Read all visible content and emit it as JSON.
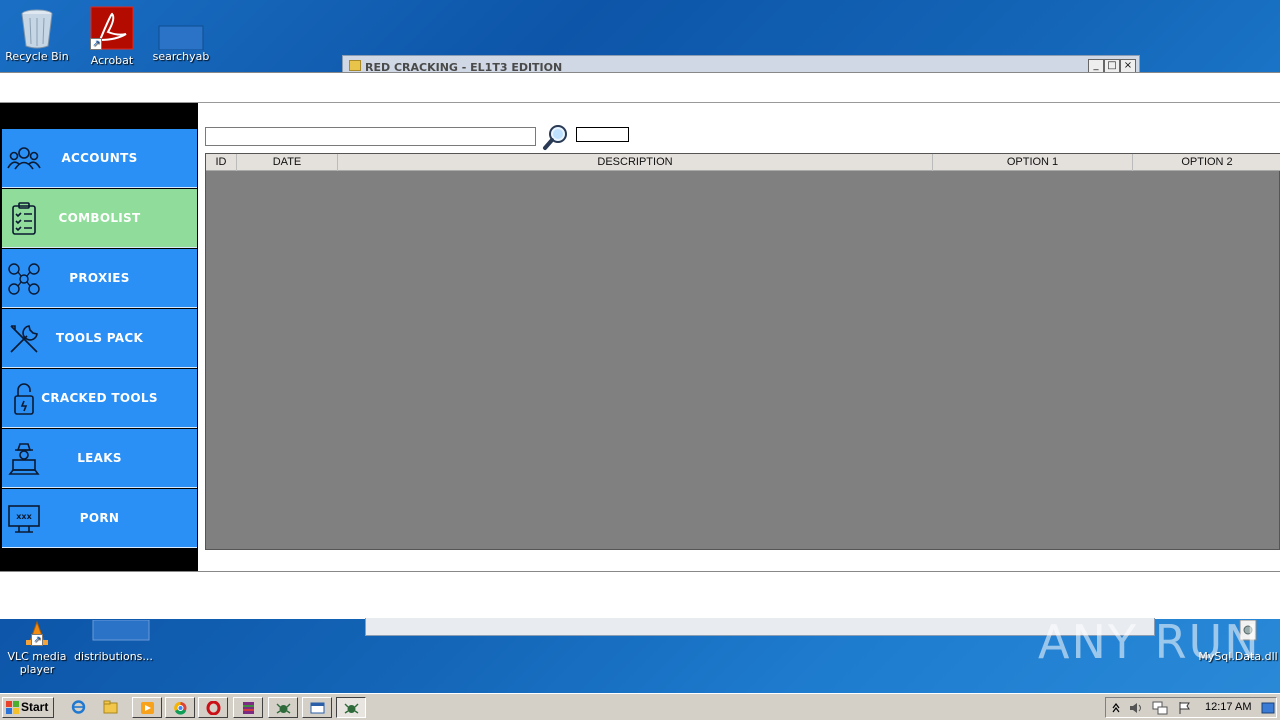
{
  "desktop": {
    "icons": [
      {
        "label": "Recycle Bin"
      },
      {
        "label": "Acrobat"
      },
      {
        "label": "searchyab"
      },
      {
        "label": "VLC media player"
      },
      {
        "label": "distributions..."
      },
      {
        "label": "MySql.Data.dll"
      }
    ],
    "watermark": "ANY RUN"
  },
  "background_window": {
    "title": "RED CRACKING - EL1T3 EDITION",
    "minimize": "_",
    "maximize": "□",
    "close": "×"
  },
  "sidebar": {
    "items": [
      {
        "label": "ACCOUNTS",
        "icon": "users-icon",
        "active": false
      },
      {
        "label": "COMBOLIST",
        "icon": "clipboard-checklist-icon",
        "active": true
      },
      {
        "label": "PROXIES",
        "icon": "network-users-icon",
        "active": false
      },
      {
        "label": "TOOLS PACK",
        "icon": "tools-icon",
        "active": false
      },
      {
        "label": "CRACKED TOOLS",
        "icon": "unlocked-padlock-icon",
        "active": false
      },
      {
        "label": "LEAKS",
        "icon": "hacker-laptop-icon",
        "active": false
      },
      {
        "label": "PORN",
        "icon": "xxx-monitor-icon",
        "active": false
      }
    ]
  },
  "search": {
    "value": "",
    "placeholder": ""
  },
  "grid": {
    "columns": [
      "ID",
      "DATE",
      "DESCRIPTION",
      "OPTION 1",
      "OPTION 2"
    ],
    "rows": []
  },
  "taskbar": {
    "start_label": "Start",
    "clock": "12:17 AM"
  },
  "colors": {
    "nav_blue": "#2a90f5",
    "nav_active_green": "#90dc9a",
    "grid_bg": "#808080"
  }
}
